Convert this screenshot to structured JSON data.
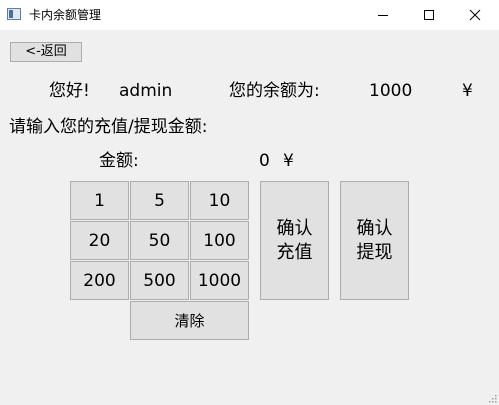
{
  "window": {
    "title": "卡内余额管理",
    "controls": [
      "minimize-icon",
      "maximize-icon",
      "close-icon"
    ]
  },
  "back_button": {
    "label": "<-返回"
  },
  "greeting": {
    "hello": "您好!",
    "username": "admin",
    "balance_label": "您的余额为:",
    "balance_value": "1000",
    "currency": "¥"
  },
  "prompt": "请输入您的充值/提现金额:",
  "amount": {
    "label": "金额:",
    "value": "0",
    "currency": "¥"
  },
  "keypad": {
    "row1": [
      "1",
      "5",
      "10"
    ],
    "row2": [
      "20",
      "50",
      "100"
    ],
    "row3": [
      "200",
      "500",
      "1000"
    ],
    "clear": "清除"
  },
  "actions": {
    "recharge_line1": "确认",
    "recharge_line2": "充值",
    "withdraw_line1": "确认",
    "withdraw_line2": "提现"
  }
}
